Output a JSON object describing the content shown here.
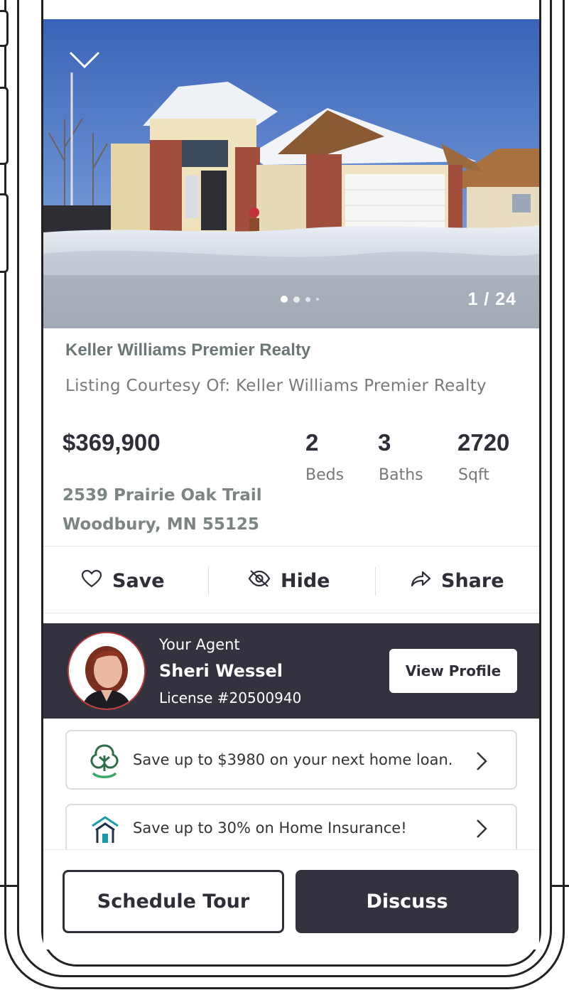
{
  "gallery": {
    "counter": "1 / 24",
    "collapse_icon": "chevron-down-icon"
  },
  "listing": {
    "brokerage": "Keller Williams Premier Realty",
    "courtesy": "Listing Courtesy Of: Keller Williams Premier Realty",
    "price": "$369,900",
    "beds_value": "2",
    "beds_label": "Beds",
    "baths_value": "3",
    "baths_label": "Baths",
    "sqft_value": "2720",
    "sqft_label": "Sqft",
    "address_line1": "2539 Prairie Oak Trail",
    "address_line2": "Woodbury, MN 55125"
  },
  "actions": {
    "save": "Save",
    "hide": "Hide",
    "share": "Share"
  },
  "agent": {
    "label": "Your Agent",
    "name": "Sheri Wessel",
    "license": "License #20500940",
    "view_profile": "View Profile"
  },
  "promos": [
    {
      "text": "Save up to $3980 on your next home loan.",
      "icon": "loan-tree-icon"
    },
    {
      "text": "Save up to 30% on Home Insurance!",
      "icon": "home-insurance-icon"
    }
  ],
  "footer": {
    "schedule_tour": "Schedule Tour",
    "discuss": "Discuss"
  },
  "colors": {
    "dark": "#33323e",
    "brand_green": "#2e8b57",
    "brand_teal": "#1a9aa8",
    "muted_green": "#7c8580"
  }
}
